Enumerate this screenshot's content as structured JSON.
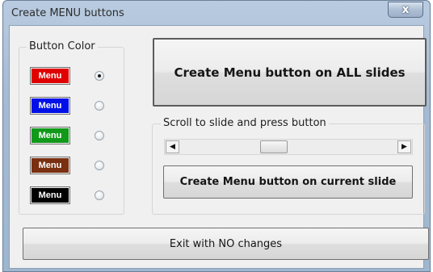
{
  "window": {
    "title": "Create MENU buttons",
    "close_glyph": "x"
  },
  "button_color_group": {
    "label": "Button Color",
    "options": [
      {
        "label": "Menu",
        "bg": "#e00000",
        "fg": "#ffffff",
        "checked": true
      },
      {
        "label": "Menu",
        "bg": "#0010e8",
        "fg": "#ffffff",
        "checked": false
      },
      {
        "label": "Menu",
        "bg": "#11991a",
        "fg": "#ffffff",
        "checked": false
      },
      {
        "label": "Menu",
        "bg": "#7a3010",
        "fg": "#ffffff",
        "checked": false
      },
      {
        "label": "Menu",
        "bg": "#000000",
        "fg": "#ffffff",
        "checked": false
      }
    ]
  },
  "actions": {
    "all_slides_label": "Create Menu button on ALL slides",
    "scroll_group_label": "Scroll to slide and press button",
    "current_slide_label": "Create Menu button on current slide",
    "exit_label": "Exit with NO changes"
  },
  "scrollbar": {
    "left_arrow": "◀",
    "right_arrow": "▶",
    "position_fraction": 0.4
  }
}
